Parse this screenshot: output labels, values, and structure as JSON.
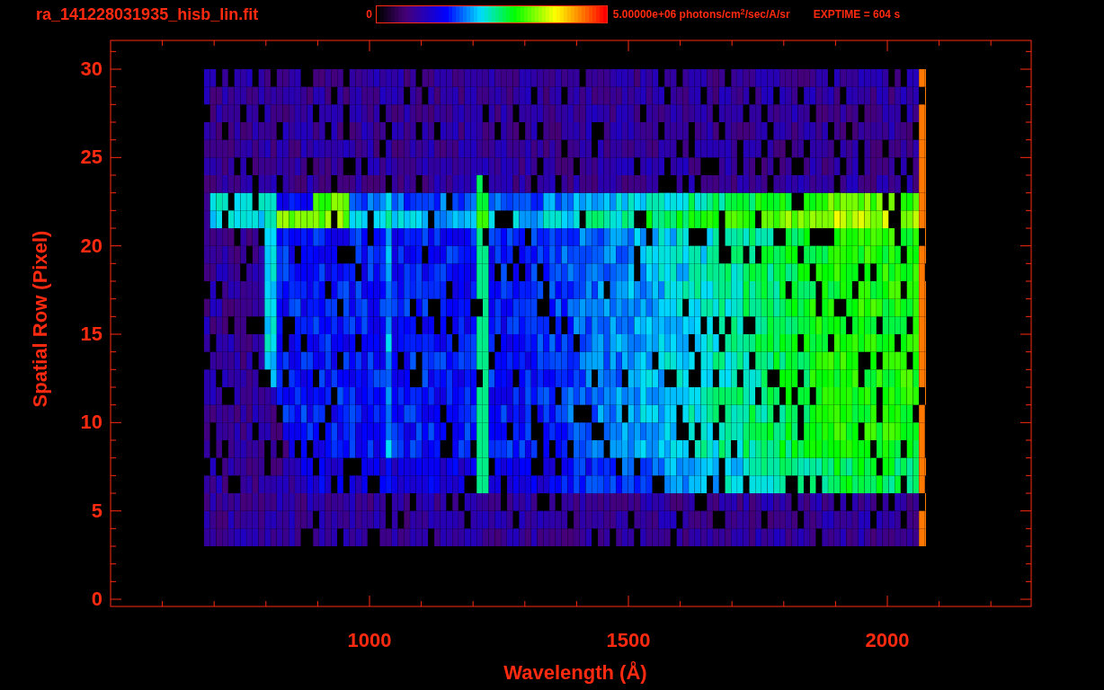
{
  "title": "ra_141228031935_hisb_lin.fit",
  "colorbar": {
    "min_label": "0",
    "max_label": "5.00000e+06 photons/cm$^{2}$/sec/A/sr"
  },
  "exposure": "EXPTIME = 604 s",
  "plot": {
    "xlabel": "Wavelength (Å)",
    "ylabel": "Spatial Row (Pixel)",
    "xticks": [
      "1000",
      "1500",
      "2000"
    ],
    "yticks": [
      "30",
      "25",
      "20",
      "15",
      "10",
      "5",
      "0"
    ]
  }
}
